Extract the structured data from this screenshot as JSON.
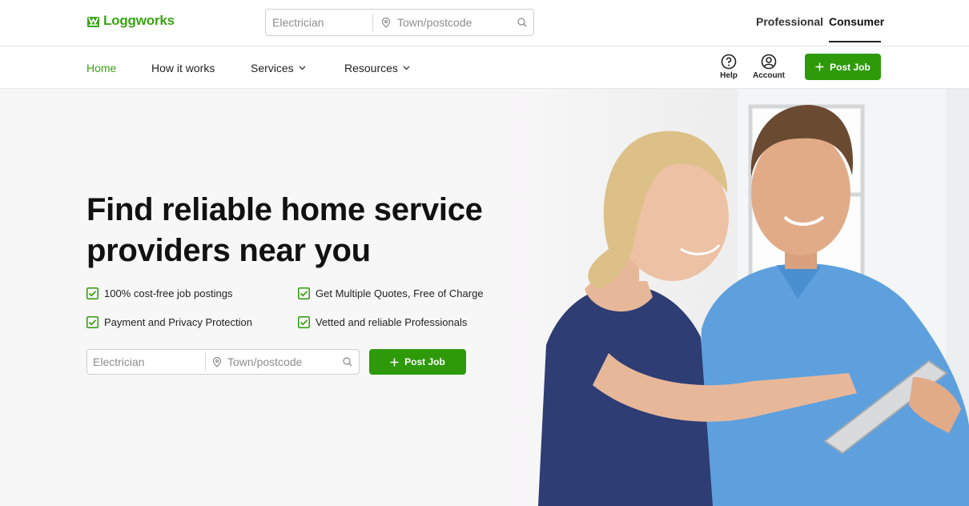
{
  "brand": {
    "name": "Loggworks",
    "accent": "#3aa312",
    "button_color": "#2e9a0a"
  },
  "top_search": {
    "service_placeholder": "Electrician",
    "location_placeholder": "Town/postcode"
  },
  "segments": {
    "professional": "Professional",
    "consumer": "Consumer",
    "selected": "Consumer"
  },
  "nav": {
    "items": [
      {
        "label": "Home",
        "active": true
      },
      {
        "label": "How it works"
      },
      {
        "label": "Services",
        "dropdown": true
      },
      {
        "label": "Resources",
        "dropdown": true
      }
    ],
    "help_label": "Help",
    "account_label": "Account",
    "post_job_label": "Post Job"
  },
  "hero": {
    "headline_line1": "Find reliable home service",
    "headline_line2": "providers near you",
    "features": [
      "100% cost-free job postings",
      "Get Multiple Quotes, Free of Charge",
      "Payment and Privacy Protection",
      "Vetted and reliable Professionals"
    ],
    "service_placeholder": "Electrician",
    "location_placeholder": "Town/postcode",
    "post_job_label": "Post Job"
  }
}
